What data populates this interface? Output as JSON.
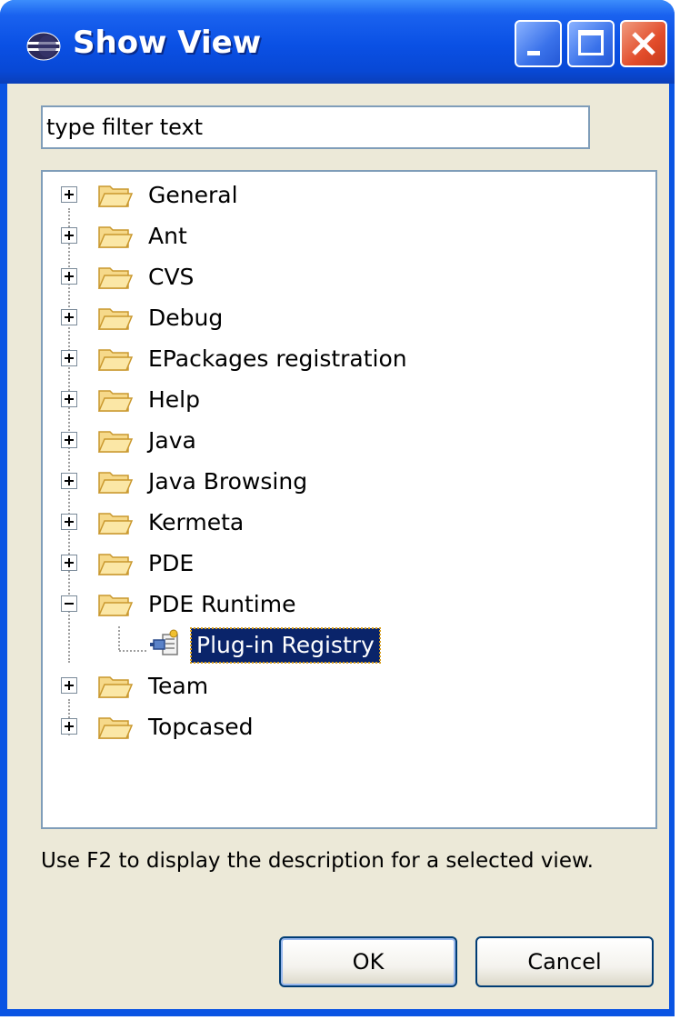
{
  "window": {
    "title": "Show View",
    "app_icon": "eclipse-icon",
    "controls": {
      "minimize_icon": "minimize-icon",
      "maximize_icon": "maximize-icon",
      "close_icon": "close-icon"
    }
  },
  "filter": {
    "value": "type filter text"
  },
  "tree": {
    "items": [
      {
        "label": "General",
        "expanded": false
      },
      {
        "label": "Ant",
        "expanded": false
      },
      {
        "label": "CVS",
        "expanded": false
      },
      {
        "label": "Debug",
        "expanded": false
      },
      {
        "label": "EPackages registration",
        "expanded": false
      },
      {
        "label": "Help",
        "expanded": false
      },
      {
        "label": "Java",
        "expanded": false
      },
      {
        "label": "Java Browsing",
        "expanded": false
      },
      {
        "label": "Kermeta",
        "expanded": false
      },
      {
        "label": "PDE",
        "expanded": false
      },
      {
        "label": "PDE Runtime",
        "expanded": true,
        "children": [
          {
            "label": "Plug-in Registry",
            "selected": true,
            "icon": "plugin-registry-icon"
          }
        ]
      },
      {
        "label": "Team",
        "expanded": false
      },
      {
        "label": "Topcased",
        "expanded": false
      }
    ]
  },
  "description": "Use F2 to display the description for a selected view.",
  "buttons": {
    "ok": "OK",
    "cancel": "Cancel"
  },
  "colors": {
    "titlebar": "#0a54e3",
    "dialog_bg": "#ece9d8",
    "selection_bg": "#0a246a",
    "close_button": "#e24c2a"
  }
}
